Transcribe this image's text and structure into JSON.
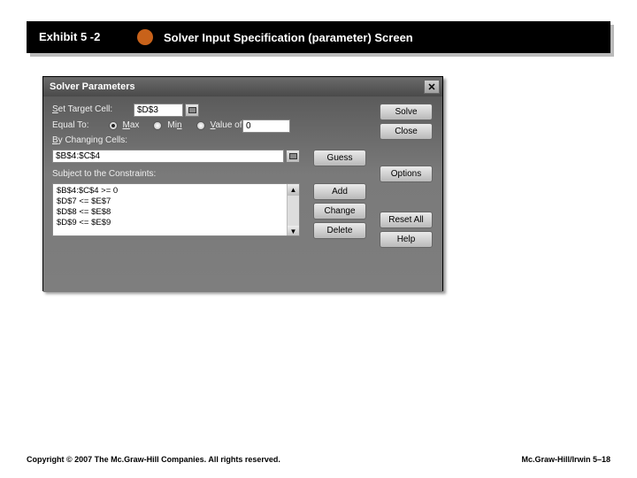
{
  "header": {
    "exhibit": "Exhibit 5 -2",
    "title": "Solver Input Specification (parameter) Screen"
  },
  "dialog": {
    "title": "Solver Parameters",
    "labels": {
      "set_target": "Set Target Cell:",
      "equal_to": "Equal To:",
      "max": "Max",
      "min": "Min",
      "value_of": "Value of:",
      "by_changing": "By Changing Cells:",
      "subject_to": "Subject to the Constraints:"
    },
    "fields": {
      "target_cell": "$D$3",
      "value_of": "0",
      "changing_cells": "$B$4:$C$4"
    },
    "constraints": [
      "$B$4:$C$4 >= 0",
      "$D$7 <= $E$7",
      "$D$8 <= $E$8",
      "$D$9 <= $E$9"
    ],
    "buttons": {
      "solve": "Solve",
      "close": "Close",
      "guess": "Guess",
      "options": "Options",
      "add": "Add",
      "change": "Change",
      "delete": "Delete",
      "reset_all": "Reset All",
      "help": "Help"
    }
  },
  "footer": {
    "left": "Copyright © 2007 The Mc.Graw-Hill Companies. All rights reserved.",
    "right": "Mc.Graw-Hill/Irwin  5–18"
  }
}
